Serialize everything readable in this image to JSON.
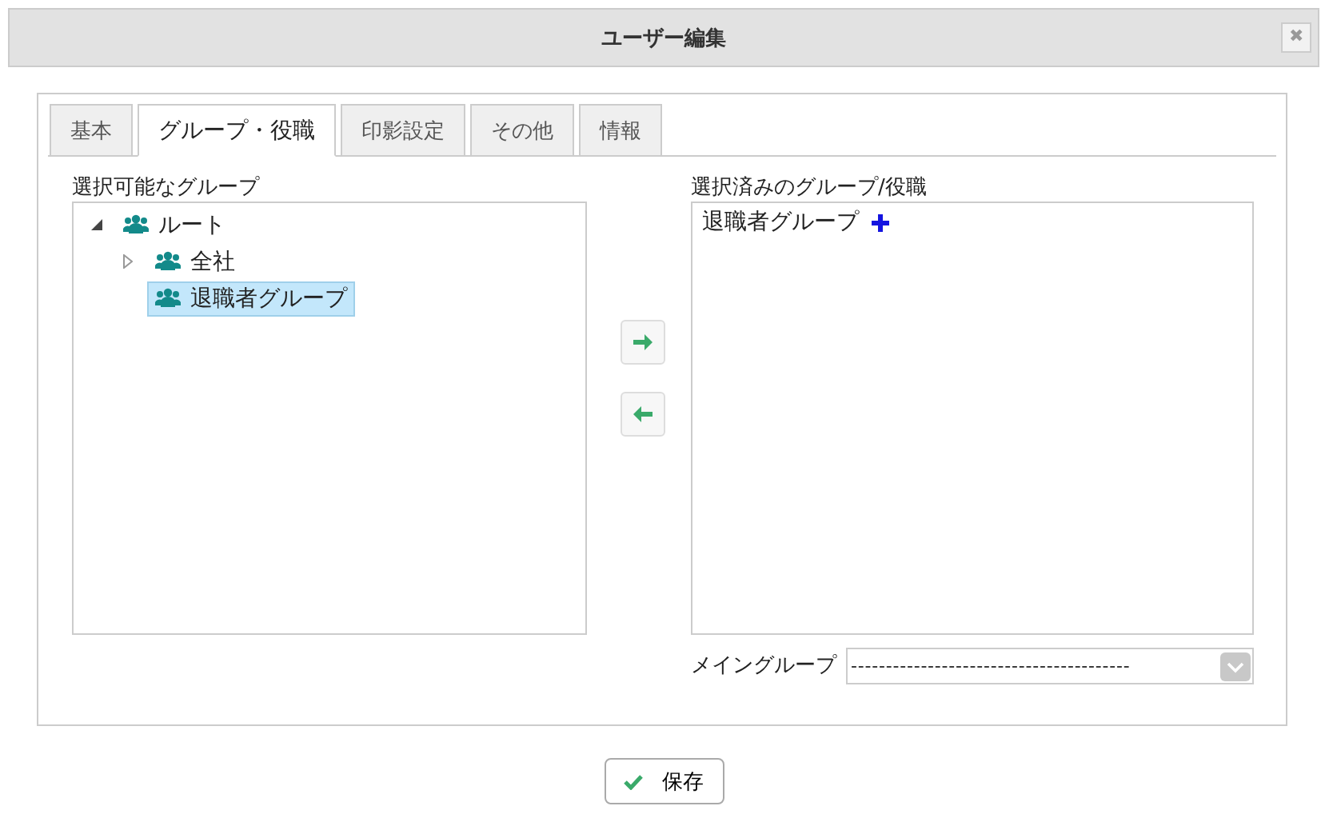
{
  "window": {
    "title": "ユーザー編集",
    "close": "✖"
  },
  "tabs": [
    {
      "label": "基本",
      "selected": false
    },
    {
      "label": "グループ・役職",
      "selected": true
    },
    {
      "label": "印影設定",
      "selected": false
    },
    {
      "label": "その他",
      "selected": false
    },
    {
      "label": "情報",
      "selected": false
    }
  ],
  "available": {
    "label": "選択可能なグループ",
    "tree": [
      {
        "label": "ルート",
        "kind": "branch",
        "expanded": true,
        "selected": false,
        "children": [
          {
            "label": "全社",
            "kind": "branch",
            "expanded": false,
            "selected": false
          },
          {
            "label": "退職者グループ",
            "kind": "leaf",
            "selected": true
          }
        ]
      }
    ]
  },
  "chosen": {
    "label": "選択済みのグループ/役職",
    "items": [
      {
        "label": "退職者グループ"
      }
    ]
  },
  "main_group": {
    "label": "メイングループ",
    "value": "----------------------------------------"
  },
  "save": {
    "label": "保存"
  }
}
